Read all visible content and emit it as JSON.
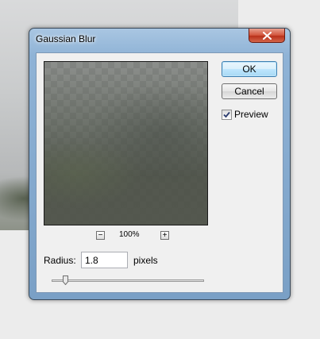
{
  "dialog": {
    "title": "Gaussian Blur",
    "close_icon": "close-icon",
    "ok_label": "OK",
    "cancel_label": "Cancel",
    "preview": {
      "label": "Preview",
      "checked": true,
      "zoom_level": "100%",
      "zoom_out_label": "−",
      "zoom_in_label": "+"
    },
    "radius": {
      "label": "Radius:",
      "value": "1.8",
      "unit": "pixels"
    },
    "slider_level": 0.09
  },
  "colors": {
    "title_bar": "#8fb3d6",
    "close_button": "#d1553c",
    "default_button_border": "#3c7fb1"
  }
}
